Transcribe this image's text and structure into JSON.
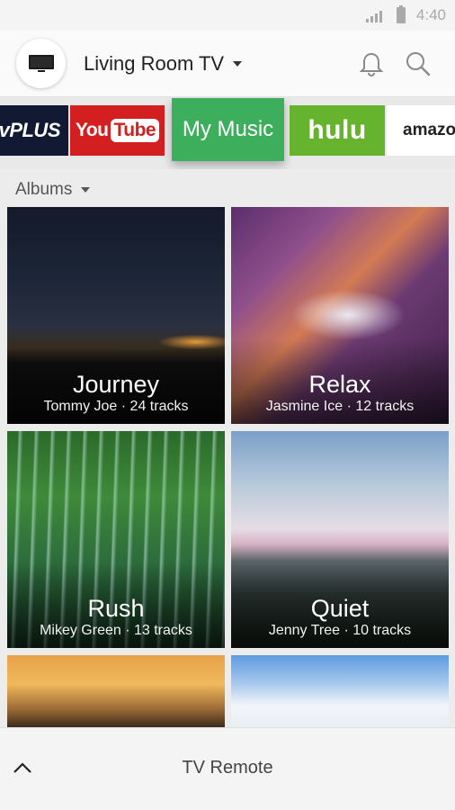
{
  "status_bar": {
    "time": "4:40",
    "icons": [
      "signal-icon",
      "battery-icon"
    ]
  },
  "header": {
    "device_name": "Living Room TV",
    "icons": [
      "tv-icon",
      "caret-down-icon",
      "bell-icon",
      "search-icon"
    ]
  },
  "apps": [
    {
      "name": "vplus",
      "label": "vPLUS"
    },
    {
      "name": "youtube",
      "label_you": "You",
      "label_tube": "Tube"
    },
    {
      "name": "my-music",
      "label": "My Music",
      "selected": true
    },
    {
      "name": "hulu",
      "label": "hulu"
    },
    {
      "name": "amazon",
      "label": "amazo"
    }
  ],
  "albums": {
    "filter_label": "Albums",
    "items": [
      {
        "title": "Journey",
        "meta": "Tommy Joe · 24 tracks"
      },
      {
        "title": "Relax",
        "meta": "Jasmine Ice · 12 tracks"
      },
      {
        "title": "Rush",
        "meta": "Mikey Green · 13 tracks"
      },
      {
        "title": "Quiet",
        "meta": "Jenny Tree · 10 tracks"
      }
    ]
  },
  "bottom_bar": {
    "label": "TV Remote",
    "icons": [
      "chevron-up-icon"
    ]
  },
  "colors": {
    "youtube_red": "#d41f20",
    "my_music_green": "#3dae5c",
    "hulu_green": "#66b32e",
    "vplus_navy": "#121a33"
  }
}
